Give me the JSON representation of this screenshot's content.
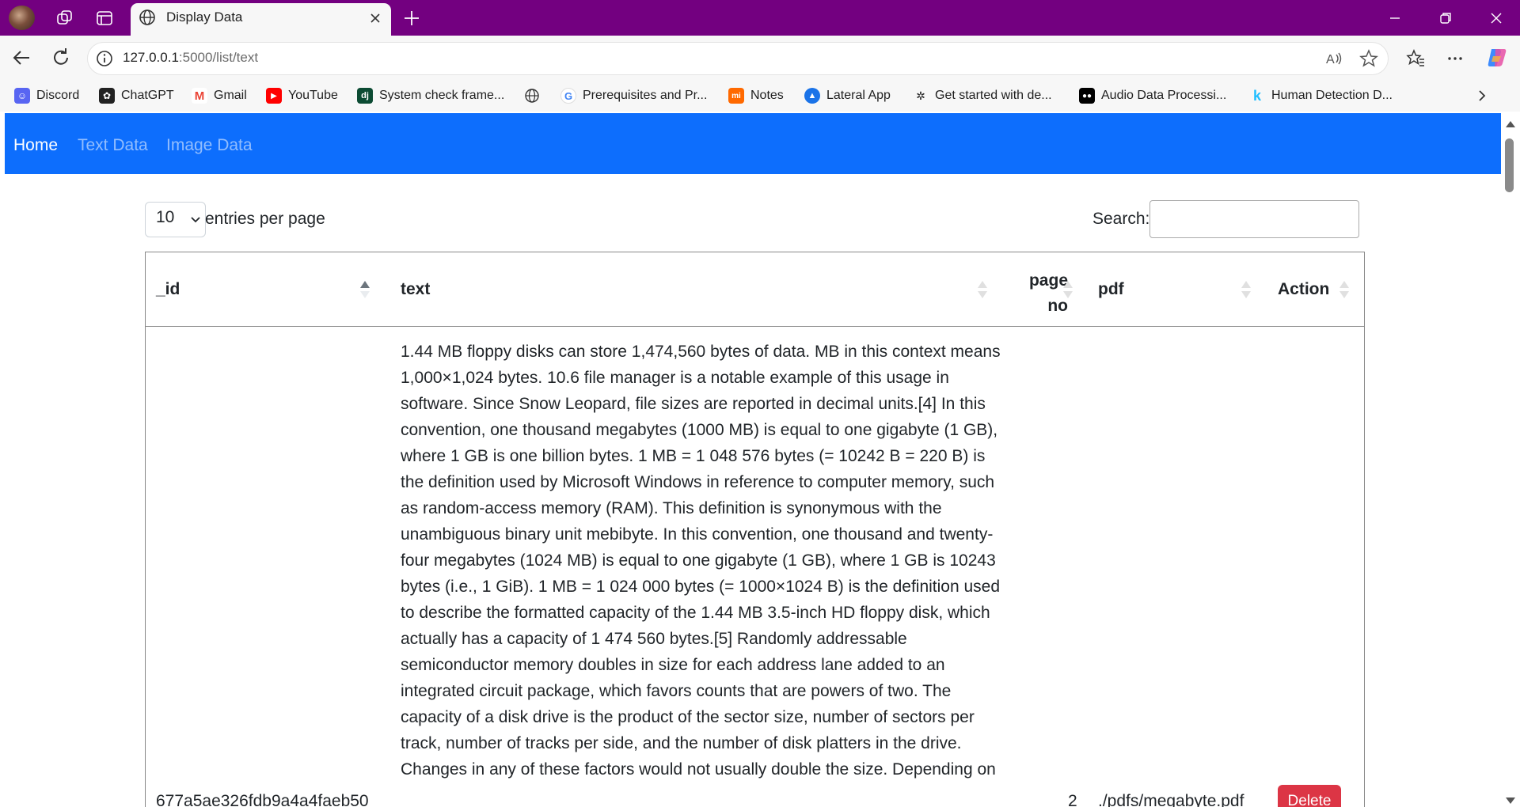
{
  "browser": {
    "tab_title": "Display Data",
    "url_host": "127.0.0.1",
    "url_rest": ":5000/list/text",
    "bookmarks": [
      {
        "label": "Discord",
        "icon": "discord-icon",
        "color": "#5865f2"
      },
      {
        "label": "ChatGPT",
        "icon": "chatgpt-icon",
        "color": "#222222"
      },
      {
        "label": "Gmail",
        "icon": "gmail-icon",
        "color": "#ea4335"
      },
      {
        "label": "YouTube",
        "icon": "youtube-icon",
        "color": "#ff0000"
      },
      {
        "label": "System check frame...",
        "icon": "django-icon",
        "color": "#0c4b33"
      },
      {
        "label": "",
        "icon": "globe-icon",
        "color": "#444444"
      },
      {
        "label": "Prerequisites and Pr...",
        "icon": "google-icon",
        "color": "#4285f4"
      },
      {
        "label": "Notes",
        "icon": "xiaomi-icon",
        "color": "#ff6900"
      },
      {
        "label": "Lateral App",
        "icon": "lateral-icon",
        "color": "#1a73e8"
      },
      {
        "label": "Get started with de...",
        "icon": "github-icon",
        "color": "#222222"
      },
      {
        "label": "Audio Data Processi...",
        "icon": "medium-icon",
        "color": "#000000"
      },
      {
        "label": "Human Detection D...",
        "icon": "kaggle-icon",
        "color": "#20beff"
      }
    ]
  },
  "navbar": {
    "brand_color": "#0d6efd",
    "links": [
      "Home",
      "Text Data",
      "Image Data"
    ]
  },
  "controls": {
    "page_length": "10",
    "page_length_label": "entries per page",
    "search_label": "Search:",
    "search_value": ""
  },
  "table": {
    "headers": [
      "_id",
      "text",
      "page\nno",
      "pdf",
      "Action"
    ],
    "rows": [
      {
        "id": "677a5ae326fdb9a4a4faeb50",
        "text": "1.44 MB floppy disks can store 1,474,560 bytes of data. MB in this context means 1,000×1,024 bytes. 10.6 file manager is a notable example of this usage in software. Since Snow Leopard, file sizes are reported in decimal units.[4] In this convention, one thousand megabytes (1000 MB) is equal to one gigabyte (1 GB), where 1 GB is one billion bytes. 1 MB = 1 048 576 bytes (= 10242 B = 220 B) is the definition used by Microsoft Windows in reference to computer memory, such as random-access memory (RAM). This definition is synonymous with the unambiguous binary unit mebibyte. In this convention, one thousand and twenty-four megabytes (1024 MB) is equal to one gigabyte (1 GB), where 1 GB is 10243 bytes (i.e., 1 GiB). 1 MB = 1 024 000 bytes (= 1000×1024 B) is the definition used to describe the formatted capacity of the 1.44 MB 3.5-inch HD floppy disk, which actually has a capacity of 1 474 560 bytes.[5] Randomly addressable semiconductor memory doubles in size for each address lane added to an integrated circuit package, which favors counts that are powers of two. The capacity of a disk drive is the product of the sector size, number of sectors per track, number of tracks per side, and the number of disk platters in the drive. Changes in any of these factors would not usually double the size. Depending on",
        "page_no": "2",
        "pdf": "./pdfs/megabyte.pdf",
        "action_label": "Delete"
      }
    ]
  },
  "colors": {
    "titlebar": "#730080",
    "delete_button": "#dc3545"
  }
}
